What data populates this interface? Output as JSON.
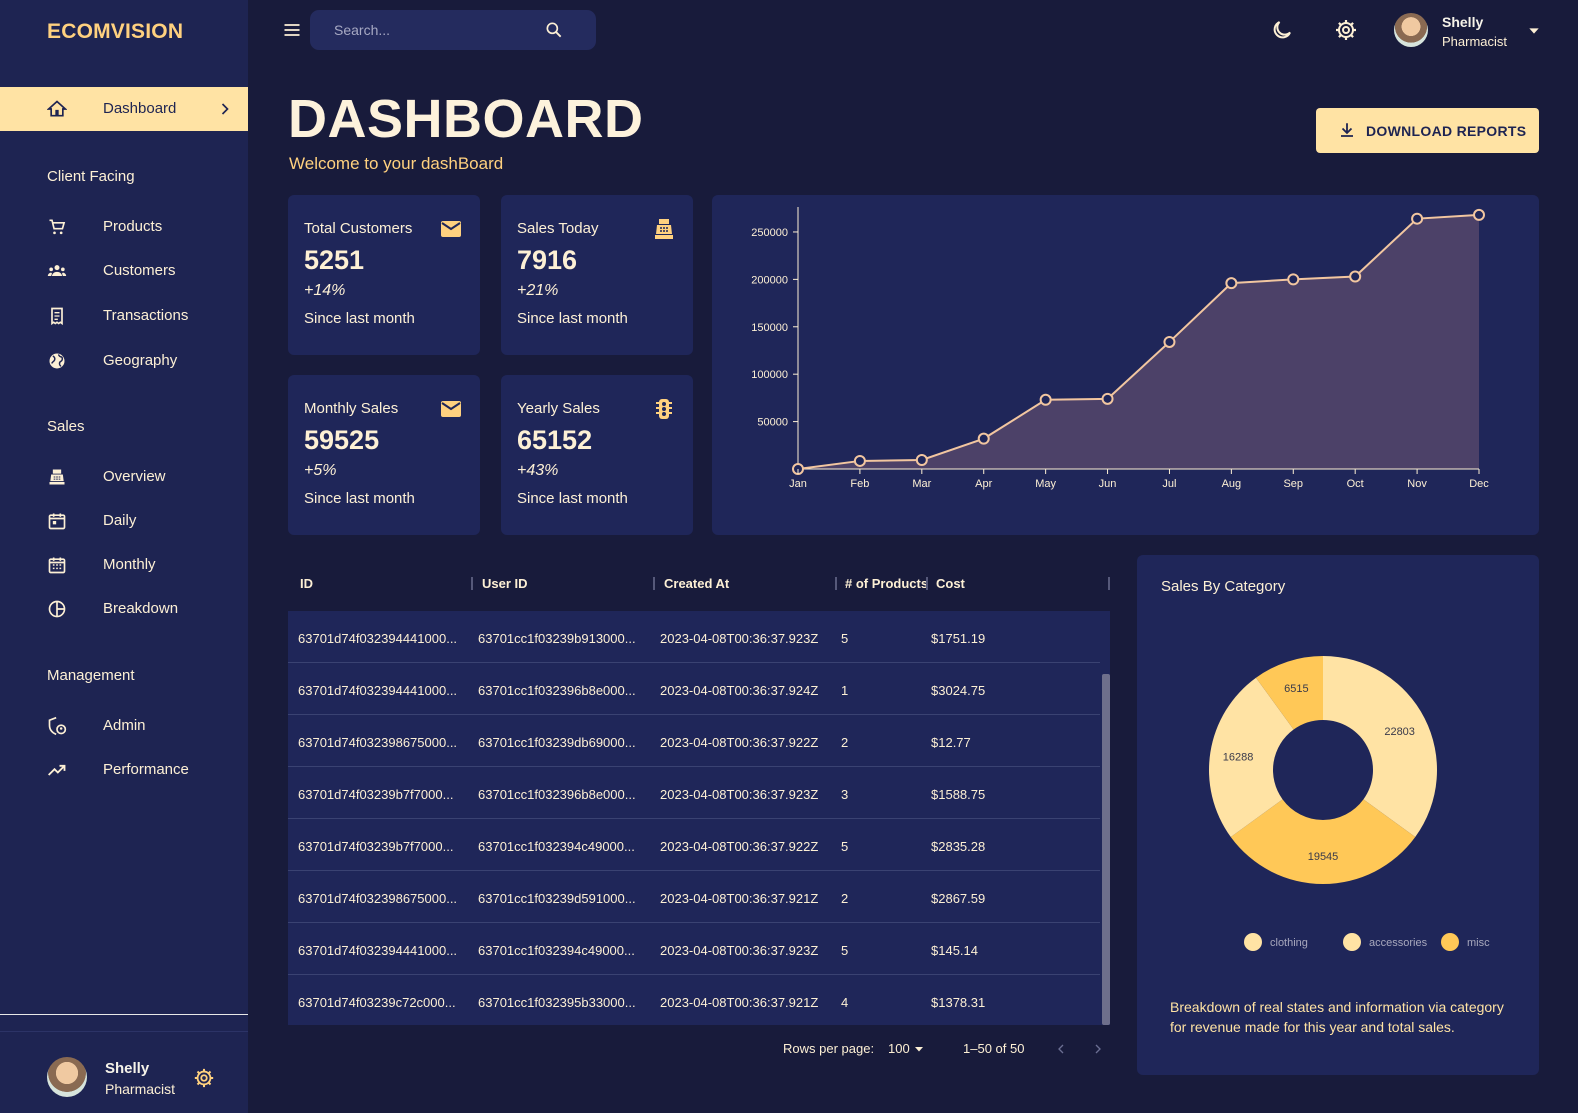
{
  "app": {
    "brand": "ECOMVISION"
  },
  "sidebar": {
    "items": [
      {
        "label": "Dashboard",
        "icon": "home-icon",
        "active": true
      },
      {
        "label": "Products",
        "icon": "cart-icon"
      },
      {
        "label": "Customers",
        "icon": "groups-icon"
      },
      {
        "label": "Transactions",
        "icon": "receipt-icon"
      },
      {
        "label": "Geography",
        "icon": "globe-icon"
      },
      {
        "label": "Overview",
        "icon": "point-of-sale-icon"
      },
      {
        "label": "Daily",
        "icon": "calendar-today-icon"
      },
      {
        "label": "Monthly",
        "icon": "calendar-month-icon"
      },
      {
        "label": "Breakdown",
        "icon": "pie-chart-icon"
      },
      {
        "label": "Admin",
        "icon": "admin-icon"
      },
      {
        "label": "Performance",
        "icon": "trending-up-icon"
      }
    ],
    "sections": [
      "Client Facing",
      "Sales",
      "Management"
    ],
    "user": {
      "name": "Shelly",
      "role": "Pharmacist"
    }
  },
  "topbar": {
    "search_placeholder": "Search...",
    "user": {
      "name": "Shelly",
      "role": "Pharmacist"
    }
  },
  "header": {
    "title": "DASHBOARD",
    "subtitle": "Welcome to your dashBoard",
    "download_label": "DOWNLOAD REPORTS"
  },
  "stats": [
    {
      "title": "Total Customers",
      "value": "5251",
      "change": "+14%",
      "since": "Since last month",
      "icon": "email-icon"
    },
    {
      "title": "Sales Today",
      "value": "7916",
      "change": "+21%",
      "since": "Since last month",
      "icon": "point-of-sale-icon"
    },
    {
      "title": "Monthly Sales",
      "value": "59525",
      "change": "+5%",
      "since": "Since last month",
      "icon": "email-icon"
    },
    {
      "title": "Yearly Sales",
      "value": "65152",
      "change": "+43%",
      "since": "Since last month",
      "icon": "traffic-icon"
    }
  ],
  "table": {
    "columns": [
      "ID",
      "User ID",
      "Created At",
      "# of Products",
      "Cost"
    ],
    "rows": [
      [
        "63701d74f032394441000...",
        "63701cc1f03239b913000...",
        "2023-04-08T00:36:37.923Z",
        "5",
        "$1751.19"
      ],
      [
        "63701d74f032394441000...",
        "63701cc1f032396b8e000...",
        "2023-04-08T00:36:37.924Z",
        "1",
        "$3024.75"
      ],
      [
        "63701d74f032398675000...",
        "63701cc1f03239db69000...",
        "2023-04-08T00:36:37.922Z",
        "2",
        "$12.77"
      ],
      [
        "63701d74f03239b7f7000...",
        "63701cc1f032396b8e000...",
        "2023-04-08T00:36:37.923Z",
        "3",
        "$1588.75"
      ],
      [
        "63701d74f03239b7f7000...",
        "63701cc1f032394c49000...",
        "2023-04-08T00:36:37.922Z",
        "5",
        "$2835.28"
      ],
      [
        "63701d74f032398675000...",
        "63701cc1f03239d591000...",
        "2023-04-08T00:36:37.921Z",
        "2",
        "$2867.59"
      ],
      [
        "63701d74f032394441000...",
        "63701cc1f032394c49000...",
        "2023-04-08T00:36:37.923Z",
        "5",
        "$145.14"
      ],
      [
        "63701d74f03239c72c000...",
        "63701cc1f032395b33000...",
        "2023-04-08T00:36:37.921Z",
        "4",
        "$1378.31"
      ]
    ],
    "pagination": {
      "rows_per_page_label": "Rows per page:",
      "rows_per_page": "100",
      "range": "1–50 of 50"
    }
  },
  "pie": {
    "title": "Sales By Category",
    "description": "Breakdown of real states and information via category for revenue made for this year and total sales."
  },
  "colors": {
    "accent": "#ffd17f",
    "bg": "#181b3b",
    "panel": "#1f2659",
    "sidebar": "#1e2452",
    "highlight": "#ffe3a4"
  },
  "chart_data": [
    {
      "type": "area",
      "x": [
        "Jan",
        "Feb",
        "Mar",
        "Apr",
        "May",
        "Jun",
        "Jul",
        "Aug",
        "Sep",
        "Oct",
        "Nov",
        "Dec"
      ],
      "values": [
        0,
        8500,
        9500,
        32000,
        73000,
        74000,
        134000,
        196000,
        200000,
        203000,
        264000,
        268000
      ],
      "yticks": [
        50000,
        100000,
        150000,
        200000,
        250000
      ],
      "ylim": [
        0,
        270000
      ],
      "grid": false,
      "color": "#f2c6a0"
    },
    {
      "type": "pie",
      "donut": true,
      "values": [
        22803,
        19545,
        16288,
        6515
      ],
      "colors": [
        "#ffe3a4",
        "#ffc857",
        "#ffe3a4",
        "#ffc857"
      ],
      "legend": [
        "clothing",
        "accessories",
        "misc"
      ],
      "legend_colors": [
        "#ffe3a4",
        "#ffe3a4",
        "#ffc857"
      ],
      "legend_placement": "bottom"
    }
  ]
}
